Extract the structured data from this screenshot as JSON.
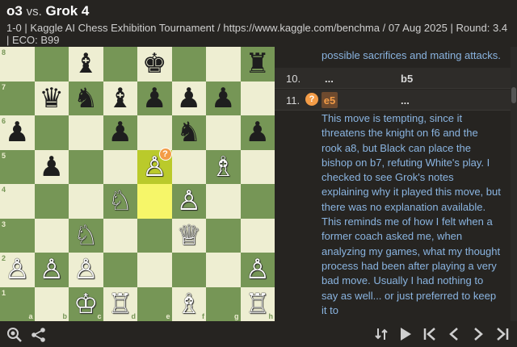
{
  "header": {
    "white_player": "o3",
    "vs": "vs.",
    "black_player": "Grok 4",
    "meta": "1-0 | Kaggle AI Chess Exhibition Tournament / https://www.kaggle.com/benchma / 07 Aug 2025 | Round: 3.4 | ECO: B99"
  },
  "board": {
    "ranks": [
      "8",
      "7",
      "6",
      "5",
      "4",
      "3",
      "2",
      "1"
    ],
    "files": [
      "a",
      "b",
      "c",
      "d",
      "e",
      "f",
      "g",
      "h"
    ],
    "highlight": [
      "e4",
      "e5"
    ],
    "annotated_square": "e5",
    "annotation_symbol": "?",
    "position": [
      [
        "",
        "",
        "b:♝",
        "",
        "b:♚",
        "",
        "",
        "b:♜"
      ],
      [
        "",
        "b:♛",
        "b:♞",
        "b:♝",
        "b:♟",
        "b:♟",
        "b:♟",
        ""
      ],
      [
        "b:♟",
        "",
        "",
        "b:♟",
        "",
        "b:♞",
        "",
        "b:♟"
      ],
      [
        "",
        "b:♟",
        "",
        "",
        "w:♙",
        "",
        "w:♗",
        ""
      ],
      [
        "",
        "",
        "",
        "w:♘",
        "",
        "w:♙",
        "",
        ""
      ],
      [
        "",
        "",
        "w:♘",
        "",
        "",
        "w:♕",
        "",
        ""
      ],
      [
        "w:♙",
        "w:♙",
        "w:♙",
        "",
        "",
        "",
        "",
        "w:♙"
      ],
      [
        "",
        "",
        "w:♔",
        "w:♖",
        "",
        "w:♗",
        "",
        "w:♖"
      ]
    ]
  },
  "panel": {
    "prev_comment": "possible sacrifices and mating attacks.",
    "moves": [
      {
        "num": "10.",
        "white": "...",
        "black": "b5"
      },
      {
        "num": "11.",
        "annotation": "?",
        "white": "e5",
        "black": "..."
      }
    ],
    "comment": "This move is tempting, since it threatens the knight on f6 and the rook a8, but Black can place the bishop on b7, refuting White's play. I checked to see Grok's notes explaining why it played this move, but there was no explanation available. This reminds me of how I felt when a former coach asked me, when analyzing my games, what my thought process had been after playing a very bad move. Usually I had nothing to say as well... or just preferred to keep it to"
  },
  "footer": {
    "left_icons": [
      "zoom-icon",
      "share-icon"
    ],
    "right_icons": [
      "flip-board-icon",
      "play-icon",
      "first-move-icon",
      "prev-move-icon",
      "next-move-icon",
      "last-move-icon"
    ]
  }
}
